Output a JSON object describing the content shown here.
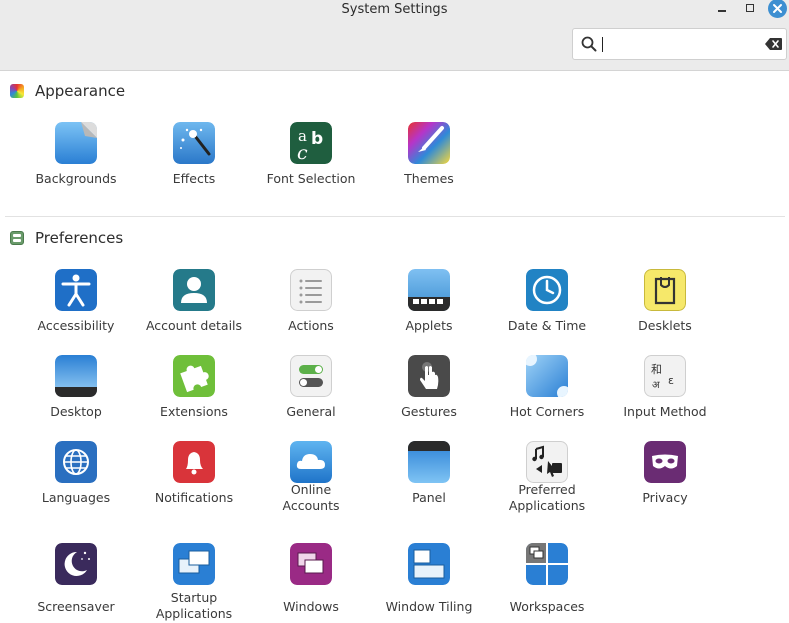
{
  "window": {
    "title": "System Settings"
  },
  "search": {
    "placeholder": "",
    "value": ""
  },
  "sections": {
    "appearance": {
      "title": "Appearance",
      "items": [
        {
          "label": "Backgrounds"
        },
        {
          "label": "Effects"
        },
        {
          "label": "Font Selection"
        },
        {
          "label": "Themes"
        }
      ]
    },
    "preferences": {
      "title": "Preferences",
      "items": [
        {
          "label": "Accessibility"
        },
        {
          "label": "Account details"
        },
        {
          "label": "Actions"
        },
        {
          "label": "Applets"
        },
        {
          "label": "Date & Time"
        },
        {
          "label": "Desklets"
        },
        {
          "label": "Desktop"
        },
        {
          "label": "Extensions"
        },
        {
          "label": "General"
        },
        {
          "label": "Gestures"
        },
        {
          "label": "Hot Corners"
        },
        {
          "label": "Input Method"
        },
        {
          "label": "Languages"
        },
        {
          "label": "Notifications"
        },
        {
          "label": "Online Accounts"
        },
        {
          "label": "Panel"
        },
        {
          "label": "Preferred Applications"
        },
        {
          "label": "Privacy"
        },
        {
          "label": "Screensaver"
        },
        {
          "label": "Startup Applications"
        },
        {
          "label": "Windows"
        },
        {
          "label": "Window Tiling"
        },
        {
          "label": "Workspaces"
        }
      ]
    }
  },
  "colors": {
    "accent": "#3d8fd1",
    "header_bg": "#ebebeb"
  }
}
